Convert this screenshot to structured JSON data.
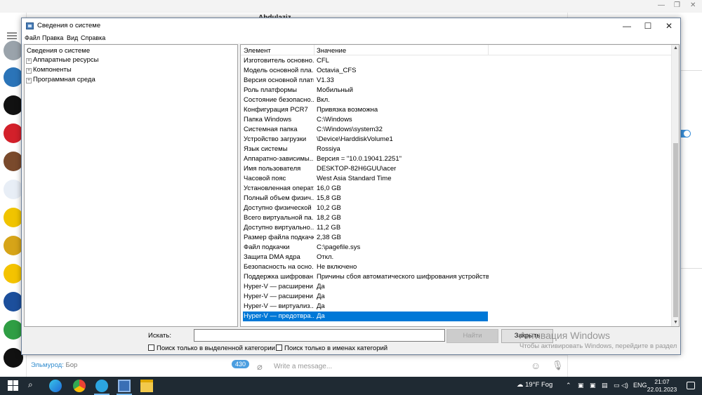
{
  "background_app": {
    "chat_header_name": "Abdulaziz",
    "chat_preview": {
      "name": "Эльмурод:",
      "text": "Бор",
      "badge": "430"
    },
    "compose_placeholder": "Write a message..."
  },
  "window": {
    "title": "Сведения о системе",
    "controls": {
      "minimize": "—",
      "maximize": "☐",
      "close": "✕"
    },
    "menu": [
      "Файл",
      "Правка",
      "Вид",
      "Справка"
    ]
  },
  "tree": {
    "root": "Сведения о системе",
    "nodes": [
      "Аппаратные ресурсы",
      "Компоненты",
      "Программная среда"
    ]
  },
  "list": {
    "headers": {
      "element": "Элемент",
      "value": "Значение"
    },
    "rows": [
      {
        "element": "Изготовитель основно...",
        "value": "CFL"
      },
      {
        "element": "Модель основной пла...",
        "value": "Octavia_CFS"
      },
      {
        "element": "Версия основной платы",
        "value": "V1.33"
      },
      {
        "element": "Роль платформы",
        "value": "Мобильный"
      },
      {
        "element": "Состояние безопасно...",
        "value": "Вкл."
      },
      {
        "element": "Конфигурация PCR7",
        "value": "Привязка возможна"
      },
      {
        "element": "Папка Windows",
        "value": "C:\\Windows"
      },
      {
        "element": "Системная папка",
        "value": "C:\\Windows\\system32"
      },
      {
        "element": "Устройство загрузки",
        "value": "\\Device\\HarddiskVolume1"
      },
      {
        "element": "Язык системы",
        "value": "Rossiya"
      },
      {
        "element": "Аппаратно-зависимы...",
        "value": "Версия = \"10.0.19041.2251\""
      },
      {
        "element": "Имя пользователя",
        "value": "DESKTOP-82H6GUU\\acer"
      },
      {
        "element": "Часовой пояс",
        "value": "West Asia Standard Time"
      },
      {
        "element": "Установленная операт...",
        "value": "16,0 GB"
      },
      {
        "element": "Полный объем физич...",
        "value": "15,8 GB"
      },
      {
        "element": "Доступно физической ...",
        "value": "10,2 GB"
      },
      {
        "element": "Всего виртуальной па...",
        "value": "18,2 GB"
      },
      {
        "element": "Доступно виртуально...",
        "value": "11,2 GB"
      },
      {
        "element": "Размер файла подкачки",
        "value": "2,38 GB"
      },
      {
        "element": "Файл подкачки",
        "value": "C:\\pagefile.sys"
      },
      {
        "element": "Защита DMA ядра",
        "value": "Откл."
      },
      {
        "element": "Безопасность на осно...",
        "value": "Не включено"
      },
      {
        "element": "Поддержка шифрован...",
        "value": "Причины сбоя автоматического шифрования устройств..."
      },
      {
        "element": "Hyper-V — расширени...",
        "value": "Да"
      },
      {
        "element": "Hyper-V — расширени...",
        "value": "Да"
      },
      {
        "element": "Hyper-V — виртуализ...",
        "value": "Да"
      },
      {
        "element": "Hyper-V — предотвра...",
        "value": "Да",
        "selected": true
      }
    ]
  },
  "search": {
    "label": "Искать:",
    "value": "",
    "find_button": "Найти",
    "close_button": "Закрыть",
    "option_selected_category": "Поиск только в выделенной категории",
    "option_category_names": "Поиск только в именах категорий"
  },
  "watermark": {
    "line1": "Активация Windows",
    "line2": "Чтобы активировать Windows, перейдите в раздел"
  },
  "taskbar": {
    "weather": "19°F Fog",
    "language": "ENG",
    "time": "21:07",
    "date": "22.01.2023"
  }
}
